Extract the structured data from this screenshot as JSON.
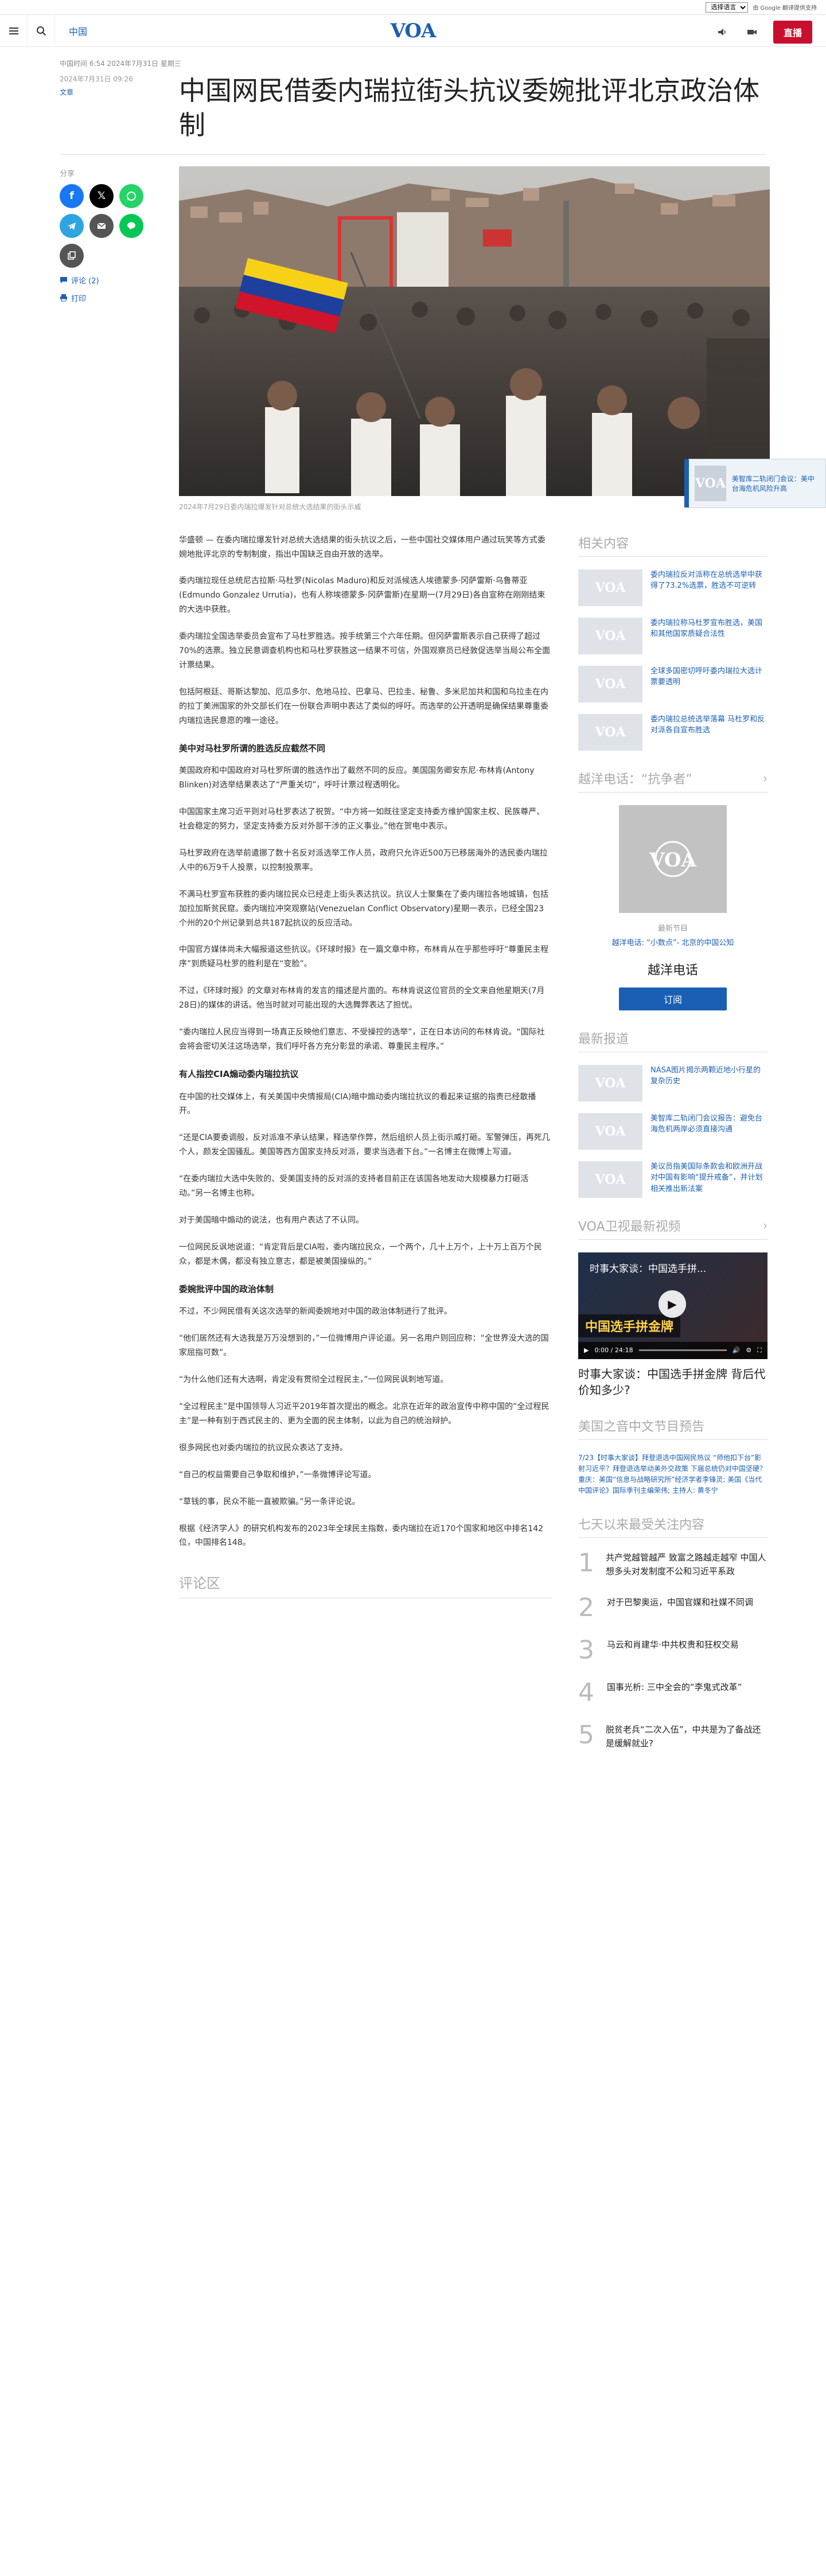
{
  "topbar": {
    "language_select": "选择语言",
    "translate_credit": "由 Google 翻译提供支持"
  },
  "header": {
    "section": "中国",
    "logo": "VOA",
    "live_label": "直播"
  },
  "article": {
    "timestamp": "2024年7月31日 09:26",
    "category": "文章",
    "updated_line": "中国时间 6:54 2024年7月31日 星期三",
    "title": "中国网民借委内瑞拉街头抗议委婉批评北京政治体制",
    "caption": "2024年7月29日委内瑞拉爆发针对总统大选结果的街头示威",
    "paragraphs": [
      {
        "type": "p",
        "text": "华盛顿 — 在委内瑞拉爆发针对总统大选结果的街头抗议之后，一些中国社交媒体用户通过玩笑等方式委婉地批评北京的专制制度，指出中国缺乏自由开放的选举。"
      },
      {
        "type": "p",
        "text": "委内瑞拉现任总统尼古拉斯·马杜罗(Nicolas Maduro)和反对派候选人埃德蒙多·冈萨雷斯·乌鲁蒂亚(Edmundo Gonzalez Urrutia)，也有人称埃德蒙多·冈萨雷斯)在星期一(7月29日)各自宣称在刚刚结束的大选中获胜。"
      },
      {
        "type": "p",
        "text": "委内瑞拉全国选举委员会宣布了马杜罗胜选。按手统第三个六年任期。但冈萨雷斯表示自己获得了超过70%的选票。独立民意调查机构也和马杜罗获胜这一结果不可信，外国观察员已经敦促选举当局公布全面计票结果。"
      },
      {
        "type": "p",
        "text": "包括阿根廷、哥斯达黎加、厄瓜多尔、危地马拉、巴拿马、巴拉圭、秘鲁、多米尼加共和国和乌拉圭在内的拉丁美洲国家的外交部长们在一份联合声明中表达了类似的呼吁。而选举的公开透明是确保结果尊重委内瑞拉选民意愿的唯一途径。"
      },
      {
        "type": "h",
        "text": "美中对马杜罗所谓的胜选反应截然不同"
      },
      {
        "type": "p",
        "text": "美国政府和中国政府对马杜罗所谓的胜选作出了截然不同的反应。美国国务卿安东尼·布林肯(Antony Blinken)对选举结果表达了“严重关切”，呼吁计票过程透明化。"
      },
      {
        "type": "p",
        "text": "中国国家主席习近平则对马杜罗表达了祝贺。“中方将一如既往坚定支持委方维护国家主权、民族尊严、社会稳定的努力，坚定支持委方反对外部干涉的正义事业。”他在贺电中表示。"
      },
      {
        "type": "p",
        "text": "马杜罗政府在选举前遣挪了数十名反对派选举工作人员，政府只允许近500万已移居海外的选民委内瑞拉人中的6万9千人投票，以控制投票率。"
      },
      {
        "type": "p",
        "text": "不满马杜罗宣布获胜的委内瑞拉民众已经走上街头表达抗议。抗议人士聚集在了委内瑞拉各地城镇，包括加拉加斯贫民窟。委内瑞拉冲突观察站(Venezuelan Conflict Observatory)星期一表示，已经全国23个州的20个州记录到总共187起抗议的反应活动。"
      },
      {
        "type": "p",
        "text": "中国官方媒体尚未大幅报道这些抗议。《环球时报》在一篇文章中称，布林肯从在乎那些呼吁“尊重民主程序”到质疑马杜罗的胜利是在“变脸”。"
      },
      {
        "type": "p",
        "text": "不过，《环球时报》的文章对布林肯的发言的描述是片面的。布林肯说这位官员的全文来自他星期天(7月28日)的媒体的讲话。他当时就对可能出现的大选舞弊表达了担忧。"
      },
      {
        "type": "p",
        "text": "“委内瑞拉人民应当得到一场真正反映他们意志、不受操控的选举”，正在日本访问的布林肯说。“国际社会将会密切关注这场选举，我们呼吁各方充分彰显的承诺、尊重民主程序。”"
      },
      {
        "type": "h",
        "text": "有人指控CIA煽动委内瑞拉抗议"
      },
      {
        "type": "p",
        "text": "在中国的社交媒体上，有关美国中央情报局(CIA)暗中煽动委内瑞拉抗议的看起来证据的指责已经散播开。"
      },
      {
        "type": "p",
        "text": "“还是CIA要委调般，反对派准不承认结果，释选举作弊，然后组织人员上街示威打砸。军警弹压，再死几个人，颜发全国骚乱。美国等西方国家支持反对派，要求当选者下台。”一名博主在微博上写道。"
      },
      {
        "type": "p",
        "text": "“在委内瑞拉大选中失败的、受美国支持的反对派的支持者目前正在该国各地发动大规模暴力打砸活动。”另一名博主也称。"
      },
      {
        "type": "p",
        "text": "对于美国暗中煽动的说法，也有用户表达了不认同。"
      },
      {
        "type": "p",
        "text": "一位网民反讽地说道：“肯定背后是CIA啦，委内瑞拉民众，一个两个，几十上万个，上十万上百万个民众，都是木偶，都没有独立意志，都是被美国操纵的。”"
      },
      {
        "type": "h",
        "text": "委婉批评中国的政治体制"
      },
      {
        "type": "p",
        "text": "不过，不少网民借有关这次选举的新闻委婉地对中国的政治体制进行了批评。"
      },
      {
        "type": "p",
        "text": "“他们居然还有大选我是万万没想到的，”一位微博用户评论道。另一名用户则回应称：“全世界没大选的国家屈指可数”。"
      },
      {
        "type": "p",
        "text": "“为什么他们还有大选啊，肯定没有贯彻全过程民主，”一位网民讽刺地写道。"
      },
      {
        "type": "p",
        "text": "“全过程民主”是中国领导人习近平2019年首次提出的概念。北京在近年的政治宣传中称中国的“全过程民主”是一种有别于西式民主的、更为全面的民主体制，以此为自己的统治辩护。"
      },
      {
        "type": "p",
        "text": "很多网民也对委内瑞拉的抗议民众表达了支持。"
      },
      {
        "type": "p",
        "text": "“自己的权益需要自己争取和维护，”一条微博评论写道。"
      },
      {
        "type": "p",
        "text": "“草钱的事，民众不能一直被欺骗。”另一条评论说。"
      },
      {
        "type": "p",
        "text": "根据《经济学人》的研究机构发布的2023年全球民主指数，委内瑞拉在近170个国家和地区中排名142位，中国排名148。"
      }
    ],
    "comments_heading": "评论区"
  },
  "share": {
    "label": "分享",
    "comments_link": "评论 (2)",
    "print_link": "打印"
  },
  "float_ad": {
    "text": "美智库二轨闭门会议：美中台海危机风险升高"
  },
  "sidebar": {
    "related_heading": "相关内容",
    "related": [
      {
        "text": "委内瑞拉反对派称在总统选举中获得了73.2%选票，胜选不可逆转"
      },
      {
        "text": "委内瑞拉称马杜罗宣布胜选，美国和其他国家质疑合法性"
      },
      {
        "text": "全球多国密切呼吁委内瑞拉大选计票要透明"
      },
      {
        "text": "委内瑞拉总统选举落幕 马杜罗和反对派各自宣布胜选"
      }
    ],
    "podcast_heading": "越洋电话：“抗争者”",
    "podcast_episode": "最新节目",
    "podcast_links": "越洋电话: “小数点”- 北京的中国公知",
    "podcast_title": "越洋电话",
    "subscribe_label": "订阅",
    "latest_heading": "最新报道",
    "latest": [
      {
        "text": "NASA图片揭示两颗近地小行星的复杂历史"
      },
      {
        "text": "美智库二轨闭门会议报告：避免台海危机两岸必须直接沟通"
      },
      {
        "text": "美议员指美国际条款会和欧洲开战对中国有影响“提升戒备”，并计划相关推出新法案"
      }
    ],
    "video_heading": "VOA卫视最新视频",
    "video": {
      "overlay_title": "时事大家谈：中国选手拼...",
      "banner": "中国选手拼金牌",
      "time": "0:00 / 24:18",
      "progress": 0,
      "caption": "时事大家谈：中国选手拼金牌 背后代价知多少?"
    },
    "schedule_heading": "美国之音中文节目预告",
    "schedule_text": "7/23【时事大家谈】拜登退选中国网民热议 “师他扣下台”影射习近平？拜登退选举动美外交政策 下届总统仍对中国坚硬？ 重庆：美国“信息与战略研究所”经济学者李锋灵; 美国《当代中国评论》国际季刊主编荣伟; 主持人: 黄冬宁",
    "popular_heading": "七天以来最受关注内容",
    "popular": [
      {
        "num": "1",
        "text": "共产党越管越严 致富之路越走越窄 中国人想多头对发制度不公和习近平系政"
      },
      {
        "num": "2",
        "text": "对于巴黎奥运，中国官媒和社媒不同调"
      },
      {
        "num": "3",
        "text": "马云和肖建华·中共权贵和狂权交易"
      },
      {
        "num": "4",
        "text": "国事光析: 三中全会的“李鬼式改革”"
      },
      {
        "num": "5",
        "text": "脱贫老兵“二次入伍”，中共是为了备战还是缓解就业?"
      }
    ]
  },
  "colors": {
    "brand_blue": "#1a5fb4",
    "live_red": "#c8102e"
  }
}
